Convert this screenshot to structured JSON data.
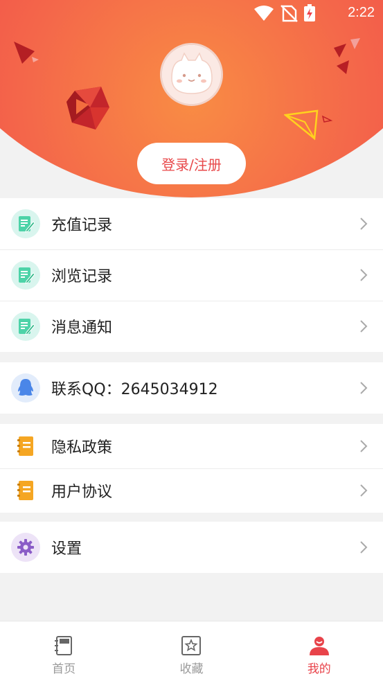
{
  "status_bar": {
    "time": "2:22"
  },
  "header": {
    "login_label": "登录/注册"
  },
  "menu": {
    "group1": [
      {
        "label": "充值记录"
      },
      {
        "label": "浏览记录"
      },
      {
        "label": "消息通知"
      }
    ],
    "group2": [
      {
        "label": "联系QQ：2645034912"
      }
    ],
    "group3": [
      {
        "label": "隐私政策"
      },
      {
        "label": "用户协议"
      }
    ],
    "group4": [
      {
        "label": "设置"
      }
    ]
  },
  "bottom_nav": {
    "items": [
      {
        "label": "首页",
        "icon": "home-book-icon",
        "active": false
      },
      {
        "label": "收藏",
        "icon": "star-icon",
        "active": false
      },
      {
        "label": "我的",
        "icon": "user-icon",
        "active": true
      }
    ]
  },
  "colors": {
    "accent": "#e8434a",
    "header_red": "#ef4149",
    "header_orange": "#f98c44",
    "green_icon_bg": "#d9f5ee",
    "green_icon": "#4dd3a8",
    "qq_icon_bg": "#e2ecfb",
    "qq_icon": "#4a86e8",
    "doc_icon": "#f5a623",
    "settings_icon_bg": "#ede3f7",
    "settings_icon": "#8a5cc7"
  }
}
